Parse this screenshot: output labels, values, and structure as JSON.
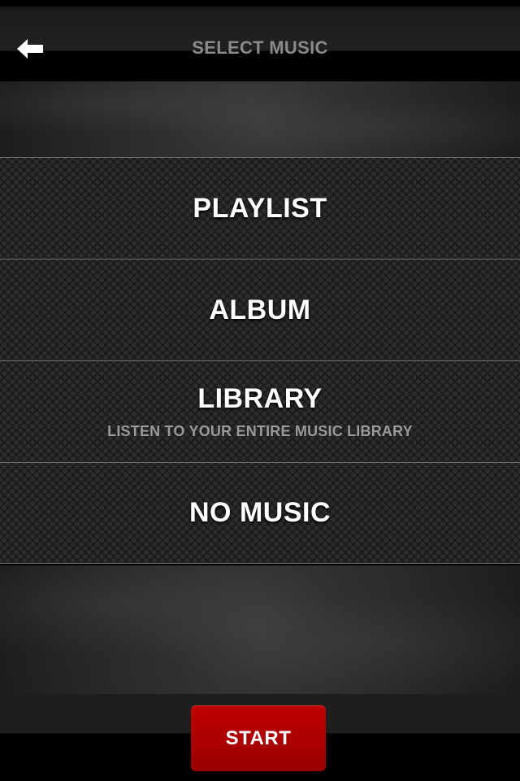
{
  "header": {
    "title": "SELECT MUSIC",
    "back_icon": "arrow-left-icon"
  },
  "menu": {
    "items": [
      {
        "label": "PLAYLIST",
        "sublabel": ""
      },
      {
        "label": "ALBUM",
        "sublabel": ""
      },
      {
        "label": "LIBRARY",
        "sublabel": "LISTEN TO YOUR ENTIRE MUSIC LIBRARY"
      },
      {
        "label": "NO MUSIC",
        "sublabel": ""
      }
    ]
  },
  "footer": {
    "start_label": "START",
    "start_color": "#b00000"
  }
}
